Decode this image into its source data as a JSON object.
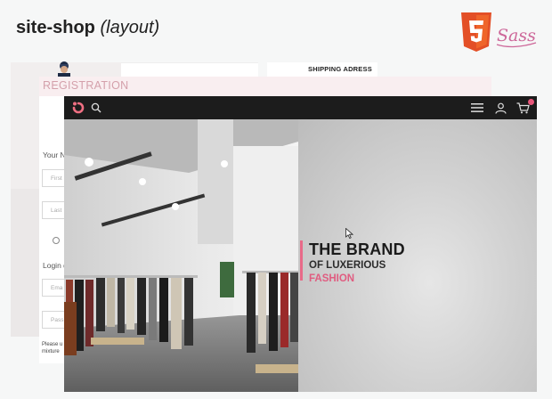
{
  "header": {
    "title": "site-shop",
    "subtitle": "(layout)"
  },
  "logos": {
    "html5": "html5-logo",
    "sass": "sass-logo"
  },
  "background_screens": {
    "shipping_label": "SHIPPING ADRESS",
    "registration_title": "REGISTRATION",
    "form": {
      "name_label": "Your N",
      "first_placeholder": "First",
      "last_placeholder": "Last",
      "login_label": "Login d",
      "email_placeholder": "Ema",
      "password_placeholder": "Pass",
      "note_line1": "Please u",
      "note_line2": "mixture"
    }
  },
  "front_screen": {
    "nav": {
      "icons": [
        "logo-icon",
        "search-icon",
        "menu-icon",
        "user-icon",
        "cart-icon"
      ],
      "cart_badge_color": "#e8567a"
    },
    "hero": {
      "line1": "THE BRAND",
      "line2": "OF LUXERIOUS",
      "line3": "FASHION",
      "accent_color": "#e86a88"
    }
  }
}
